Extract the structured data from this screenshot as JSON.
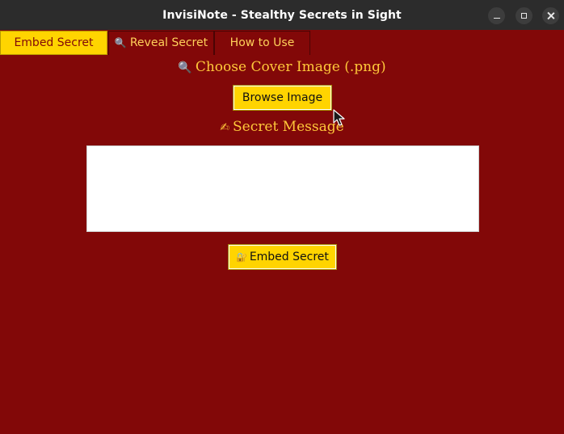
{
  "window": {
    "title": "InvisiNote - Stealthy Secrets in Sight",
    "controls": [
      "minimize-icon",
      "maximize-icon",
      "close-icon"
    ]
  },
  "tabs": [
    {
      "label": "Embed Secret",
      "icon": "",
      "active": true
    },
    {
      "label": "Reveal Secret",
      "icon": "🔍",
      "active": false
    },
    {
      "label": "How to Use",
      "icon": "",
      "active": false
    }
  ],
  "embed": {
    "cover_heading_icon": "🔍",
    "cover_heading": "Choose Cover Image (.png)",
    "browse_label": "Browse Image",
    "message_heading_icon": "✍",
    "message_heading": "Secret Message",
    "message_value": "",
    "embed_icon": "🔐",
    "embed_label": "Embed Secret"
  },
  "colors": {
    "background": "#820808",
    "accent": "#ffd400",
    "heading_text": "#ffc83a",
    "titlebar": "#2c2c2c"
  }
}
